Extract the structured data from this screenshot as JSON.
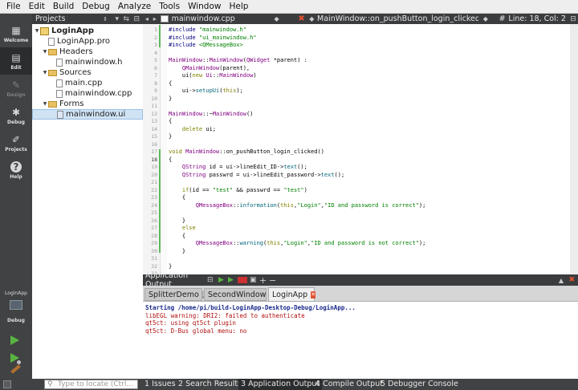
{
  "menu": [
    "File",
    "Edit",
    "Build",
    "Debug",
    "Analyze",
    "Tools",
    "Window",
    "Help"
  ],
  "modes": [
    {
      "label": "Welcome",
      "icon": "grid-icon"
    },
    {
      "label": "Edit",
      "icon": "document-icon"
    },
    {
      "label": "Design",
      "icon": "pencil-icon"
    },
    {
      "label": "Debug",
      "icon": "bug-icon"
    },
    {
      "label": "Projects",
      "icon": "wrench-icon"
    },
    {
      "label": "Help",
      "icon": "help-icon"
    }
  ],
  "kit": {
    "project": "LoginApp",
    "config": "Debug"
  },
  "projects_panel": {
    "title": "Projects"
  },
  "tree": [
    {
      "label": "LoginApp",
      "type": "project",
      "depth": 0
    },
    {
      "label": "LoginApp.pro",
      "type": "file",
      "depth": 1
    },
    {
      "label": "Headers",
      "type": "folder",
      "depth": 1
    },
    {
      "label": "mainwindow.h",
      "type": "file",
      "depth": 2
    },
    {
      "label": "Sources",
      "type": "folder",
      "depth": 1
    },
    {
      "label": "main.cpp",
      "type": "file",
      "depth": 2
    },
    {
      "label": "mainwindow.cpp",
      "type": "file",
      "depth": 2
    },
    {
      "label": "Forms",
      "type": "folder",
      "depth": 1
    },
    {
      "label": "mainwindow.ui",
      "type": "uifile",
      "depth": 2,
      "selected": true
    }
  ],
  "editor": {
    "filename": "mainwindow.cpp",
    "symbol": "MainWindow::on_pushButton_login_clicked(): v...",
    "hash": "#",
    "position": "Line: 18, Col: 2",
    "current_line": 18,
    "lines": [
      "#include \"mainwindow.h\"",
      "#include \"ui_mainwindow.h\"",
      "#include <QMessageBox>",
      "",
      "MainWindow::MainWindow(QWidget *parent) :",
      "    QMainWindow(parent),",
      "    ui(new Ui::MainWindow)",
      "{",
      "    ui->setupUi(this);",
      "}",
      "",
      "MainWindow::~MainWindow()",
      "{",
      "    delete ui;",
      "}",
      "",
      "void MainWindow::on_pushButton_login_clicked()",
      "{",
      "    QString id = ui->lineEdit_ID->text();",
      "    QString passwrd = ui->lineEdit_password->text();",
      "",
      "    if(id == \"test\" && passwrd == \"test\")",
      "    {",
      "        QMessageBox::information(this,\"Login\",\"ID and password is correct\");",
      "",
      "    }",
      "    else",
      "    {",
      "        QMessageBox::warning(this,\"Login\",\"ID and password is not correct\");",
      "    }",
      "",
      "}",
      ""
    ]
  },
  "output_panel": {
    "title": "Application Output",
    "tabs": [
      {
        "label": "SplitterDemo",
        "active": false
      },
      {
        "label": "SecondWindow",
        "active": false
      },
      {
        "label": "LoginApp",
        "active": true
      }
    ],
    "lines": [
      {
        "text": "Starting /home/pi/build-LoginApp-Desktop-Debug/LoginApp...",
        "color": "#1a2a8c",
        "bold": true
      },
      {
        "text": "libEGL warning: DRI2: failed to authenticate",
        "color": "#b01010",
        "bold": false
      },
      {
        "text": "qt5ct: using qt5ct plugin",
        "color": "#b01010",
        "bold": false
      },
      {
        "text": "qt5ct: D-Bus global menu: no",
        "color": "#b01010",
        "bold": false
      }
    ]
  },
  "locator": {
    "placeholder": "Type to locate (Ctrl..."
  },
  "status_tabs": [
    "1 Issues",
    "2 Search Results",
    "3 Application Output",
    "4 Compile Output",
    "5 Debugger Console"
  ],
  "colors": {
    "keyword": "#808000",
    "type": "#800080",
    "string": "#008000",
    "class": "#800080",
    "accent": "#e05030"
  }
}
